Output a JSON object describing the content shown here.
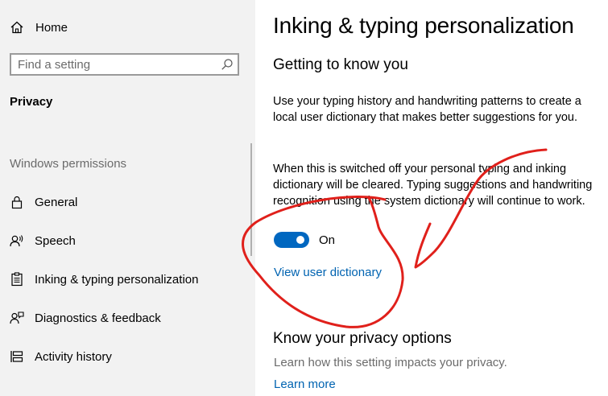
{
  "sidebar": {
    "home_label": "Home",
    "search_placeholder": "Find a setting",
    "section_title": "Privacy",
    "group_label": "Windows permissions",
    "items": [
      {
        "label": "General",
        "icon": "lock-icon"
      },
      {
        "label": "Speech",
        "icon": "speech-icon"
      },
      {
        "label": "Inking & typing personalization",
        "icon": "clipboard-icon"
      },
      {
        "label": "Diagnostics & feedback",
        "icon": "feedback-icon"
      },
      {
        "label": "Activity history",
        "icon": "timeline-icon"
      }
    ]
  },
  "main": {
    "title": "Inking & typing personalization",
    "section_title": "Getting to know you",
    "para1": "Use your typing history and handwriting patterns to create a local user dictionary that makes better suggestions for you.",
    "para2": "When this is switched off your personal typing and inking dictionary will be cleared. Typing suggestions and handwriting recognition using the system dictionary will continue to work.",
    "toggle_state": "On",
    "toggle_on": true,
    "view_dictionary_link": "View user dictionary",
    "privacy_title": "Know your privacy options",
    "privacy_text": "Learn how this setting impacts your privacy.",
    "learn_more_link": "Learn more"
  },
  "colors": {
    "accent": "#0067c0",
    "link": "#0063b1",
    "sidebar_bg": "#f2f2f2",
    "annotation": "#e0201b"
  }
}
